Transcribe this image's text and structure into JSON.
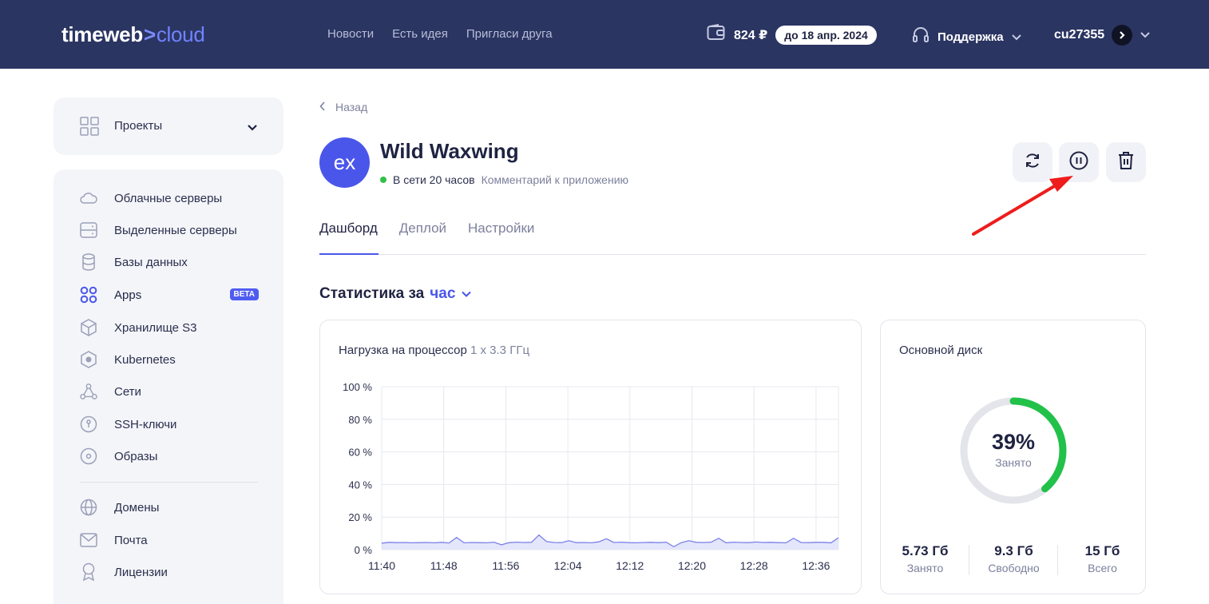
{
  "header": {
    "logo_main": "timeweb",
    "logo_sep": ">",
    "logo_sub": "cloud",
    "nav": [
      "Новости",
      "Есть идея",
      "Пригласи друга"
    ],
    "balance": "824 ₽",
    "balance_until": "до 18 апр. 2024",
    "support_label": "Поддержка",
    "username": "cu27355"
  },
  "sidebar": {
    "projects_label": "Проекты",
    "items": [
      {
        "label": "Облачные серверы",
        "icon": "cloud-icon"
      },
      {
        "label": "Выделенные серверы",
        "icon": "server-icon"
      },
      {
        "label": "Базы данных",
        "icon": "database-icon"
      },
      {
        "label": "Apps",
        "icon": "apps-icon",
        "badge": "BETA",
        "active": true
      },
      {
        "label": "Хранилище S3",
        "icon": "storage-box-icon"
      },
      {
        "label": "Kubernetes",
        "icon": "kubernetes-icon"
      },
      {
        "label": "Сети",
        "icon": "network-icon"
      },
      {
        "label": "SSH-ключи",
        "icon": "ssh-key-icon"
      },
      {
        "label": "Образы",
        "icon": "image-disk-icon"
      },
      {
        "label": "Домены",
        "icon": "globe-icon"
      },
      {
        "label": "Почта",
        "icon": "mail-icon"
      },
      {
        "label": "Лицензии",
        "icon": "license-icon"
      }
    ]
  },
  "main": {
    "back_label": "Назад",
    "avatar_text": "ex",
    "app_name": "Wild Waxwing",
    "status": "В сети 20 часов",
    "comment_link": "Комментарий к приложению",
    "tabs": [
      {
        "label": "Дашборд",
        "active": true
      },
      {
        "label": "Деплой",
        "active": false
      },
      {
        "label": "Настройки",
        "active": false
      }
    ],
    "stats_prefix": "Статистика за",
    "stats_period": "час"
  },
  "cpu_card": {
    "title": "Нагрузка на процессор",
    "spec": "1 x 3.3 ГГц"
  },
  "chart_data": {
    "type": "area",
    "title": "Нагрузка на процессор",
    "y_ticks": [
      "100 %",
      "80 %",
      "60 %",
      "40 %",
      "20 %",
      "0 %"
    ],
    "ylim": [
      0,
      100
    ],
    "x_ticks": [
      "11:40",
      "11:48",
      "11:56",
      "12:04",
      "12:12",
      "12:20",
      "12:28",
      "12:36"
    ],
    "grid": true,
    "series": [
      {
        "values": [
          4,
          4.5,
          4.3,
          4.4,
          4.2,
          4.3,
          4.4,
          4.2,
          4.5,
          4.1,
          7.5,
          4.2,
          4.4,
          4.3,
          4.2,
          4.6,
          3.0,
          4.3,
          4.6,
          4.4,
          4.5,
          9.0,
          5.0,
          4.4,
          4.3,
          5.5,
          4.3,
          4.4,
          4.2,
          4.8,
          6.7,
          4.4,
          4.6,
          4.3,
          4.2,
          4.4,
          4.5,
          4.3,
          4.6,
          1.8,
          4.3,
          5.5,
          4.5,
          4.4,
          4.6,
          7.0,
          4.2,
          4.6,
          4.4,
          4.3,
          4.7,
          4.4,
          4.5,
          4.3,
          4.2,
          7.0,
          4.4,
          4.3,
          4.5,
          4.5,
          4.2,
          7.3
        ]
      }
    ],
    "colors": {
      "line": "#7b82e8",
      "fill": "#e4e6fb",
      "grid": "#e6e8ef"
    }
  },
  "disk_card": {
    "title": "Основной диск",
    "percent_label": "39%",
    "percent_value": 39,
    "center_caption": "Занято",
    "stats": [
      {
        "value": "5.73 Гб",
        "label": "Занято"
      },
      {
        "value": "9.3 Гб",
        "label": "Свободно"
      },
      {
        "value": "15 Гб",
        "label": "Всего"
      }
    ],
    "colors": {
      "used": "#22c14a",
      "track": "#e4e5ea"
    }
  },
  "actions": [
    {
      "icon": "restart-icon"
    },
    {
      "icon": "pause-icon"
    },
    {
      "icon": "trash-icon"
    }
  ]
}
